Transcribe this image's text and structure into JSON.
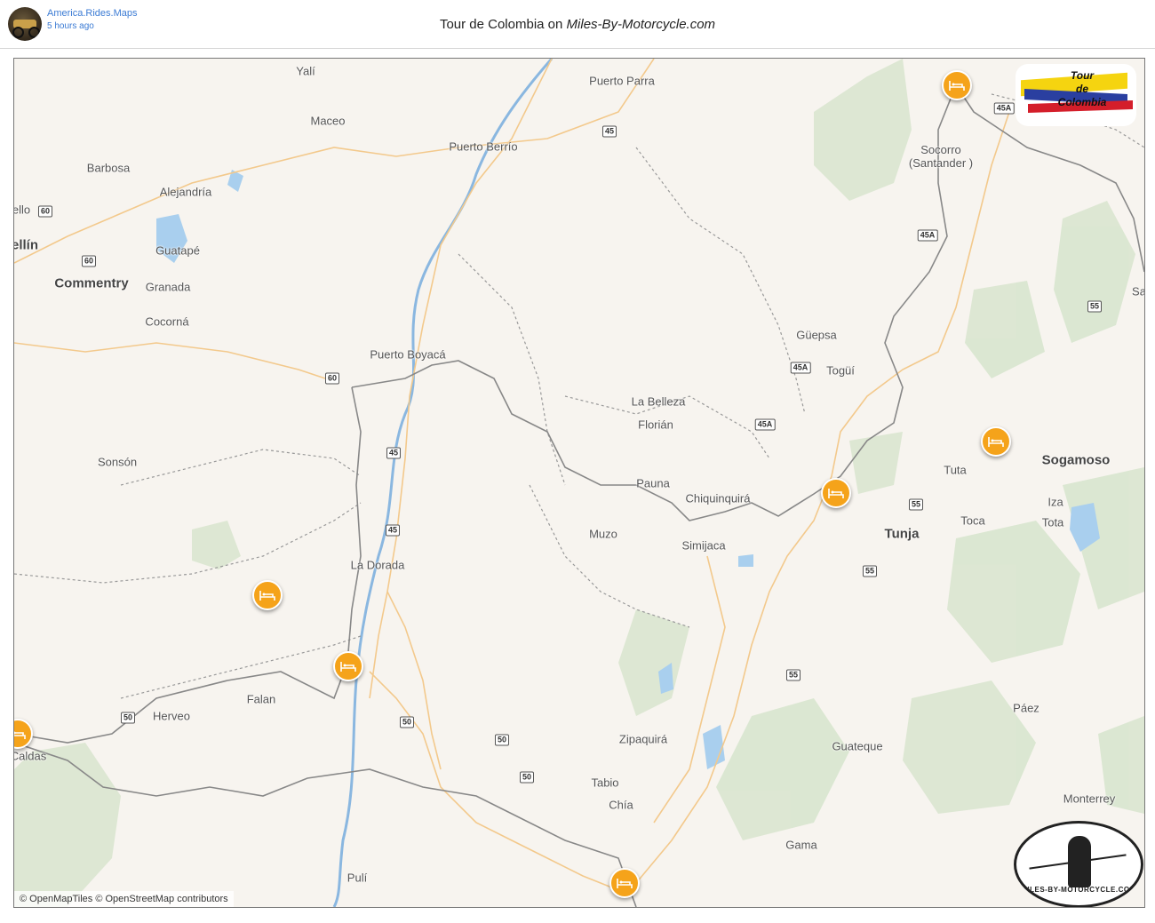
{
  "header": {
    "author": "America.Rides.Maps",
    "posted": "5 hours ago",
    "title_prefix": "Tour de Colombia on ",
    "title_site": "Miles-By-Motorcycle.com"
  },
  "map": {
    "attribution": "© OpenMapTiles © OpenStreetMap contributors",
    "places": [
      {
        "name": "Yalí"
      },
      {
        "name": "Maceo"
      },
      {
        "name": "Puerto Parra"
      },
      {
        "name": "Puerto Berrío"
      },
      {
        "name": "Barbosa"
      },
      {
        "name": "Alejandría"
      },
      {
        "name": "ello"
      },
      {
        "name": "ellín"
      },
      {
        "name": "Guatapé"
      },
      {
        "name": "Commentry"
      },
      {
        "name": "Granada"
      },
      {
        "name": "Cocorná"
      },
      {
        "name": "Puerto Boyacá"
      },
      {
        "name": "Socorro (Santander )"
      },
      {
        "name": "Güepsa"
      },
      {
        "name": "Togüí"
      },
      {
        "name": "La Belleza"
      },
      {
        "name": "Florián"
      },
      {
        "name": "Sonsón"
      },
      {
        "name": "Sogamoso"
      },
      {
        "name": "Tuta"
      },
      {
        "name": "Pauna"
      },
      {
        "name": "Chiquinquirá"
      },
      {
        "name": "Iza"
      },
      {
        "name": "Muzo"
      },
      {
        "name": "Toca"
      },
      {
        "name": "Tota"
      },
      {
        "name": "Tunja"
      },
      {
        "name": "Simijaca"
      },
      {
        "name": "La Dorada"
      },
      {
        "name": "Falan"
      },
      {
        "name": "Herveo"
      },
      {
        "name": "Páez"
      },
      {
        "name": "Caldas"
      },
      {
        "name": "Zipaquirá"
      },
      {
        "name": "Guateque"
      },
      {
        "name": "Tabio"
      },
      {
        "name": "Chía"
      },
      {
        "name": "Monterrey"
      },
      {
        "name": "Gama"
      },
      {
        "name": "Pulí"
      },
      {
        "name": "Sa"
      }
    ],
    "shields": [
      "60",
      "60",
      "45",
      "45A",
      "45A",
      "45A",
      "45A",
      "60",
      "55",
      "45",
      "45",
      "55",
      "55",
      "55",
      "50",
      "50",
      "50",
      "50"
    ],
    "markers": [
      "hotel-marker",
      "hotel-marker",
      "hotel-marker",
      "hotel-marker",
      "hotel-marker",
      "hotel-marker",
      "hotel-marker"
    ],
    "logo_tour": [
      "Tour",
      "de",
      "Colombia"
    ],
    "logo_mbm": "MILES-BY-MOTORCYCLE.COM"
  }
}
